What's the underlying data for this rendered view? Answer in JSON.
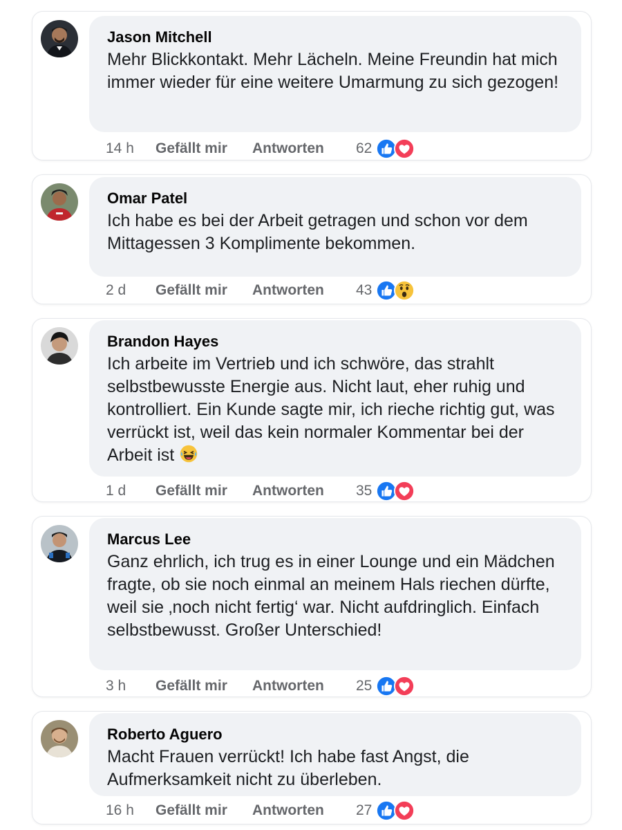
{
  "comments": [
    {
      "name": "Jason Mitchell",
      "text": "Mehr Blickkontakt. Mehr Lächeln. Meine Freundin hat mich immer wieder für eine weitere Umarmung zu sich gezogen!",
      "time": "14 h",
      "like_label": "Gefällt mir",
      "reply_label": "Antworten",
      "reaction_count": "62",
      "reactions": [
        "like-icon",
        "love-icon"
      ]
    },
    {
      "name": "Omar Patel",
      "text": "Ich habe es bei der Arbeit getragen und schon vor dem Mittagessen 3 Komplimente bekommen.",
      "time": "2 d",
      "like_label": "Gefällt mir",
      "reply_label": "Antworten",
      "reaction_count": "43",
      "reactions": [
        "like-icon",
        "wow-icon"
      ]
    },
    {
      "name": "Brandon Hayes",
      "text": "Ich arbeite im Vertrieb und ich schwöre, das strahlt selbstbewusste Energie aus. Nicht laut, eher ruhig und kontrolliert. Ein Kunde sagte mir, ich rieche richtig gut, was verrückt ist, weil das kein normaler Kommentar bei der Arbeit ist",
      "trailing_emoji": "laughing-tears-emoji",
      "time": "1 d",
      "like_label": "Gefällt mir",
      "reply_label": "Antworten",
      "reaction_count": "35",
      "reactions": [
        "like-icon",
        "love-icon"
      ]
    },
    {
      "name": "Marcus Lee",
      "text": "Ganz ehrlich, ich trug es in einer Lounge und ein Mädchen fragte, ob sie noch einmal an meinem Hals riechen dürfte, weil sie ‚noch nicht fertig‘ war. Nicht aufdringlich. Einfach selbstbewusst. Großer Unterschied!",
      "time": "3 h",
      "like_label": "Gefällt mir",
      "reply_label": "Antworten",
      "reaction_count": "25",
      "reactions": [
        "like-icon",
        "love-icon"
      ]
    },
    {
      "name": "Roberto Aguero",
      "text": "Macht Frauen verrückt! Ich habe fast Angst, die Aufmerksamkeit nicht zu überleben.",
      "time": "16 h",
      "like_label": "Gefällt mir",
      "reply_label": "Antworten",
      "reaction_count": "27",
      "reactions": [
        "like-icon",
        "love-icon"
      ]
    }
  ],
  "colors": {
    "like_blue": "#1877f2",
    "love_red": "#f33e58",
    "bubble_bg": "#f0f2f5",
    "meta_gray": "#65676b"
  }
}
